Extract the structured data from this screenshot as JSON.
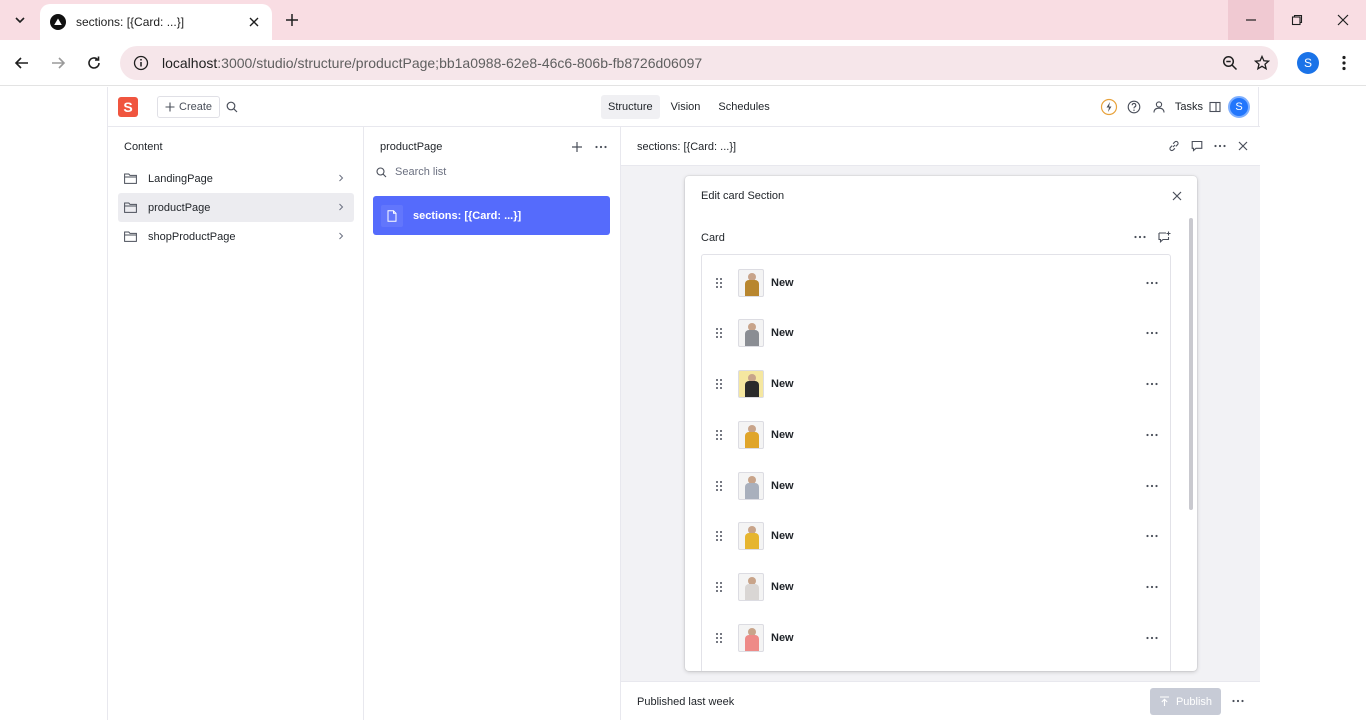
{
  "browser": {
    "tab_title": "sections: [{Card: ...}]",
    "url_host": "localhost",
    "url_rest": ":3000/studio/structure/productPage;bb1a0988-62e8-46c6-806b-fb8726d06097",
    "profile_initial": "S"
  },
  "studio": {
    "logo_letter": "S",
    "create_label": "Create",
    "tools": [
      "Structure",
      "Vision",
      "Schedules"
    ],
    "active_tool": "Structure",
    "tasks_label": "Tasks",
    "user_initial": "S"
  },
  "content_pane": {
    "title": "Content",
    "items": [
      {
        "label": "LandingPage",
        "selected": false
      },
      {
        "label": "productPage",
        "selected": true
      },
      {
        "label": "shopProductPage",
        "selected": false
      }
    ]
  },
  "list_pane": {
    "title": "productPage",
    "search_placeholder": "Search list",
    "documents": [
      {
        "label": "sections: [{Card: ...}]",
        "selected": true
      }
    ]
  },
  "document_pane": {
    "title": "sections: [{Card: ...}]",
    "dialog": {
      "title": "Edit card Section",
      "field_label": "Card",
      "items": [
        {
          "label": "New",
          "thumb_color": "#b8862e"
        },
        {
          "label": "New",
          "thumb_color": "#8a8d93"
        },
        {
          "label": "New",
          "thumb_color": "#2b2b2b"
        },
        {
          "label": "New",
          "thumb_color": "#e0a52a"
        },
        {
          "label": "New",
          "thumb_color": "#a9b0bd"
        },
        {
          "label": "New",
          "thumb_color": "#e6b52f"
        },
        {
          "label": "New",
          "thumb_color": "#d9d6d4"
        },
        {
          "label": "New",
          "thumb_color": "#ee8a87"
        }
      ]
    },
    "footer_status": "Published last week",
    "publish_label": "Publish"
  },
  "colors": {
    "accent": "#556bfc",
    "logo": "#f0553f",
    "tabstrip": "#f9dde3"
  }
}
